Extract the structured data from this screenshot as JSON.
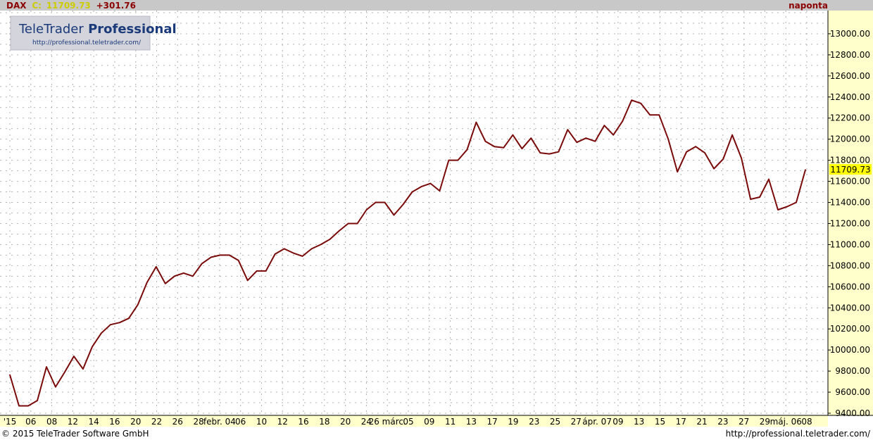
{
  "header": {
    "symbol": "DAX",
    "close_prefix": "C:",
    "close_value": "11709.73",
    "change": "+301.76",
    "period": "naponta"
  },
  "logo": {
    "title_a": "TeleTrader",
    "title_b": "Professional",
    "url": "http://professional.teletrader.com/"
  },
  "footer": {
    "copyright": "© 2015 TeleTrader Software GmbH",
    "url": "http://professional.teletrader.com/"
  },
  "last_price_label": "11709.73",
  "colors": {
    "line": "#7a0a0a",
    "header_bg": "#c8c8c8",
    "axis_bg": "#ffffcc",
    "date_bar_bg": "#ffffcc",
    "last_price_bg": "#ffff00",
    "change_color": "#8b0000",
    "close_color": "#cccc00"
  },
  "chart_data": {
    "type": "line",
    "title": "DAX",
    "ylim": [
      9380,
      13220
    ],
    "y_ticks": [
      "9400.00",
      "9600.00",
      "9800.00",
      "10000.00",
      "10200.00",
      "10400.00",
      "10600.00",
      "10800.00",
      "11000.00",
      "11200.00",
      "11400.00",
      "11600.00",
      "11800.00",
      "12000.00",
      "12200.00",
      "12400.00",
      "12600.00",
      "12800.00",
      "13000.00"
    ],
    "x_tick_labels": [
      "'15",
      "06",
      "08",
      "12",
      "14",
      "16",
      "20",
      "22",
      "26",
      "28",
      "febr. 04",
      "06",
      "10",
      "12",
      "16",
      "18",
      "20",
      "24",
      "26 márc.",
      "05",
      "09",
      "11",
      "13",
      "17",
      "19",
      "23",
      "25",
      "27",
      "ápr. 07",
      "09",
      "13",
      "15",
      "17",
      "21",
      "23",
      "27",
      "29",
      "máj. 06",
      "08"
    ],
    "series": [
      {
        "values": [
          9765,
          9470,
          9470,
          9520,
          9840,
          9650,
          9790,
          9940,
          9820,
          10030,
          10160,
          10240,
          10260,
          10300,
          10430,
          10640,
          10790,
          10630,
          10700,
          10730,
          10700,
          10820,
          10880,
          10900,
          10900,
          10850,
          10660,
          10750,
          10750,
          10910,
          10960,
          10920,
          10890,
          10960,
          11000,
          11050,
          11130,
          11200,
          11200,
          11330,
          11400,
          11400,
          11280,
          11380,
          11500,
          11550,
          11580,
          11510,
          11800,
          11800,
          11900,
          12160,
          11980,
          11930,
          11920,
          12040,
          11910,
          12010,
          11870,
          11860,
          11880,
          12090,
          11970,
          12010,
          11980,
          12130,
          12040,
          12170,
          12370,
          12340,
          12230,
          12230,
          12000,
          11690,
          11880,
          11930,
          11870,
          11720,
          11810,
          12040,
          11820,
          11430,
          11450,
          11620,
          11330,
          11360,
          11400,
          11709.73
        ]
      }
    ]
  }
}
